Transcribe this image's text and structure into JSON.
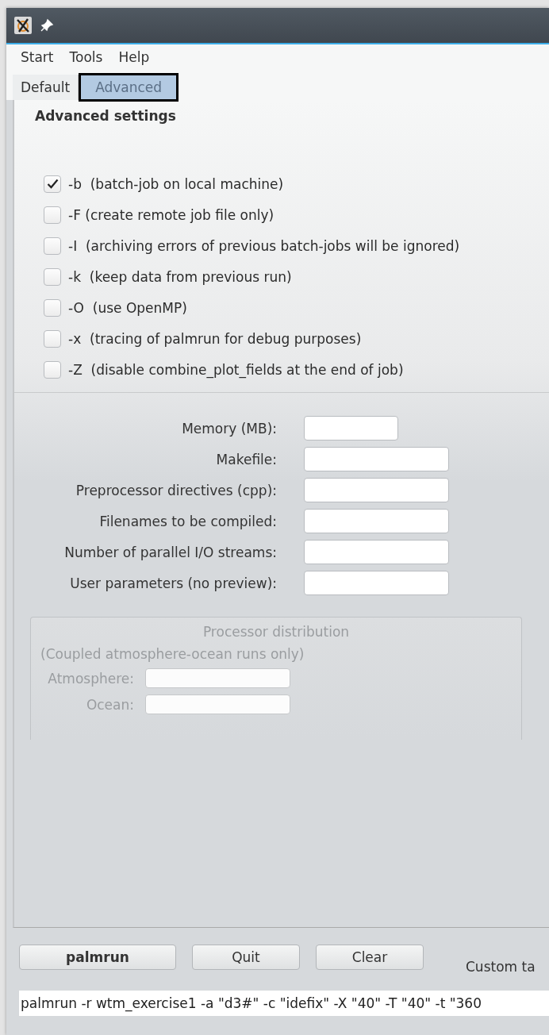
{
  "menu": [
    {
      "label": "Start"
    },
    {
      "label": "Tools"
    },
    {
      "label": "Help"
    }
  ],
  "tabs": [
    {
      "label": "Default",
      "selected": false
    },
    {
      "label": "Advanced",
      "selected": true
    }
  ],
  "heading": "Advanced settings",
  "options": [
    {
      "label": "-b  (batch-job on local machine)",
      "checked": true
    },
    {
      "label": "-F (create remote job file only)",
      "checked": false
    },
    {
      "label": "-I  (archiving errors of previous batch-jobs will be ignored)",
      "checked": false
    },
    {
      "label": "-k  (keep data from previous run)",
      "checked": false
    },
    {
      "label": "-O  (use OpenMP)",
      "checked": false
    },
    {
      "label": "-x  (tracing of palmrun for debug purposes)",
      "checked": false
    },
    {
      "label": "-Z  (disable combine_plot_fields at the end of job)",
      "checked": false
    }
  ],
  "fields": [
    {
      "label": "Memory (MB):",
      "kind": "short"
    },
    {
      "label": "Makefile:",
      "kind": "long"
    },
    {
      "label": "Preprocessor directives (cpp):",
      "kind": "long"
    },
    {
      "label": "Filenames to be compiled:",
      "kind": "long"
    },
    {
      "label": "Number of parallel I/O streams:",
      "kind": "long"
    },
    {
      "label": "User parameters (no preview):",
      "kind": "long"
    }
  ],
  "processor_distribution": {
    "title": "Processor distribution",
    "note": "(Coupled atmosphere-ocean runs only)",
    "disabled": true,
    "fields": [
      {
        "label": "Atmosphere:"
      },
      {
        "label": "Ocean:"
      }
    ]
  },
  "buttons": [
    {
      "label": "palmrun",
      "kind": "default"
    },
    {
      "label": "Quit",
      "kind": "normal"
    },
    {
      "label": "Clear",
      "kind": "normal"
    }
  ],
  "custom_label": "Custom ta",
  "command": "palmrun -r wtm_exercise1 -a \"d3#\" -c \"idefix\" -X \"40\" -T \"40\" -t \"360"
}
